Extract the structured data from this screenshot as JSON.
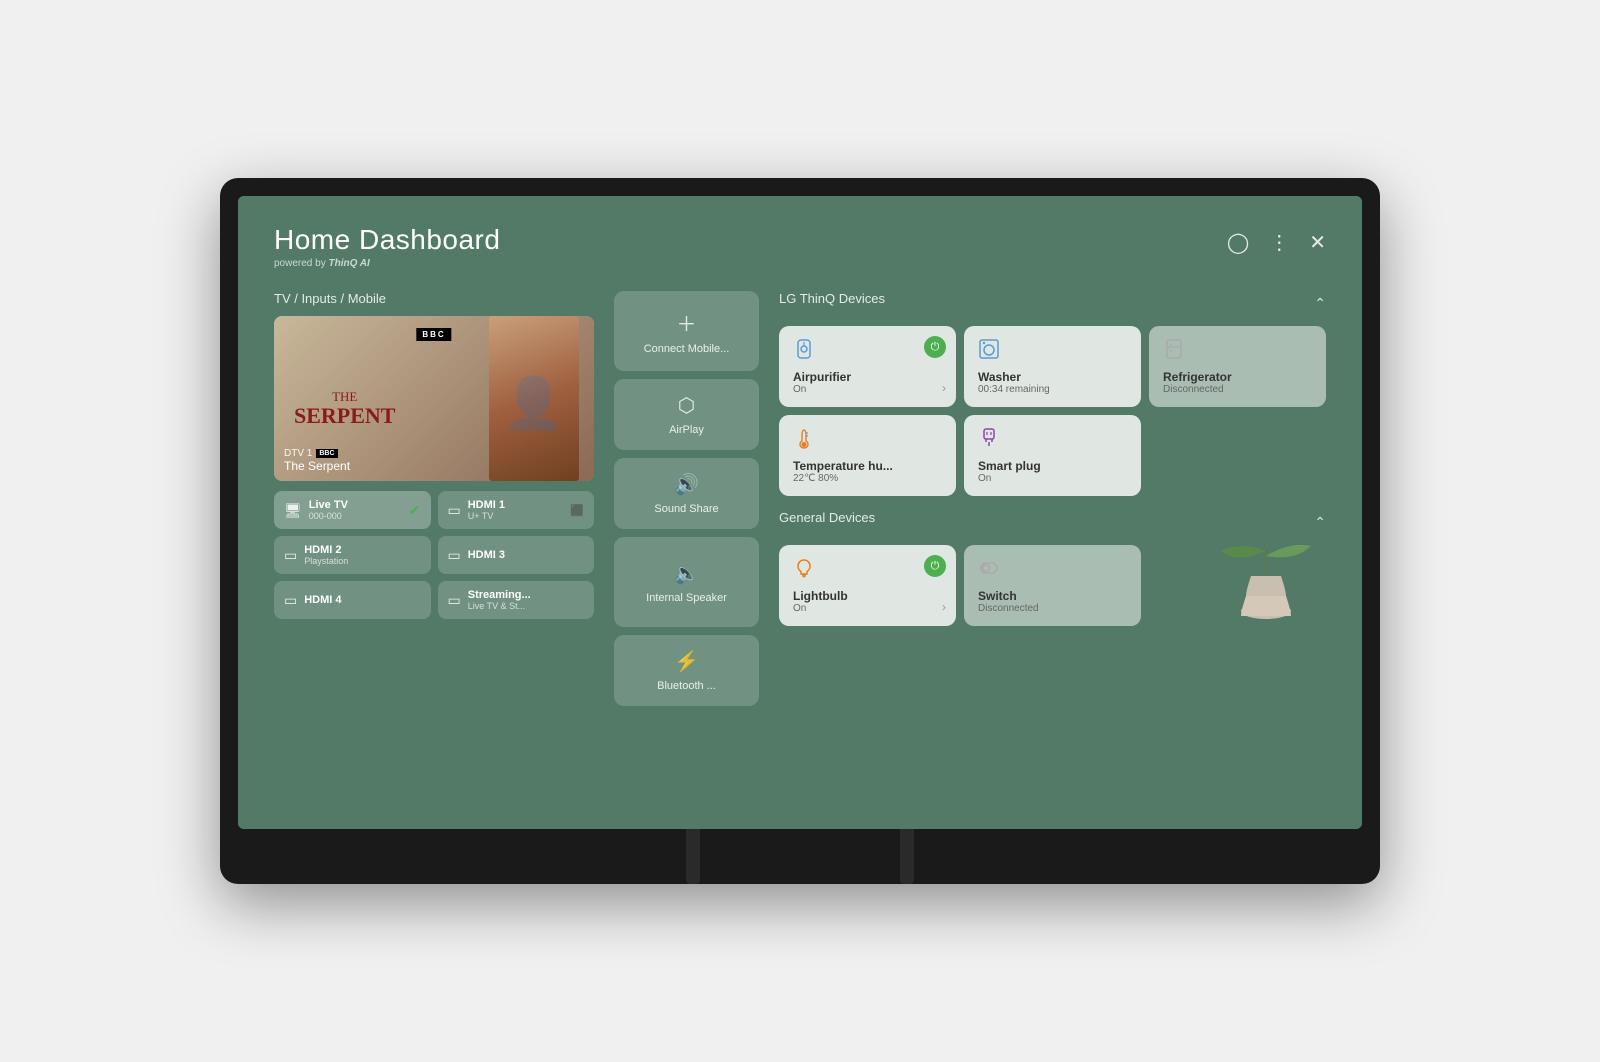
{
  "header": {
    "title": "Home Dashboard",
    "powered_by": "powered by",
    "thinq": "ThinQ AI"
  },
  "tv_inputs_section": {
    "title": "TV / Inputs / Mobile",
    "preview": {
      "channel": "DTV 1",
      "bbc_badge": "BBC",
      "show_name": "The Serpent",
      "show_title_the": "THE",
      "show_title_main": "SERPENT"
    },
    "inputs": [
      {
        "id": "live-tv",
        "name": "Live TV",
        "sub": "000-000",
        "active": true
      },
      {
        "id": "hdmi1",
        "name": "HDMI 1",
        "sub": "U+ TV",
        "active": false,
        "has_icon": true
      },
      {
        "id": "hdmi2",
        "name": "HDMI 2",
        "sub": "Playstation",
        "active": false
      },
      {
        "id": "hdmi3",
        "name": "HDMI 3",
        "sub": "",
        "active": false
      },
      {
        "id": "hdmi4",
        "name": "HDMI 4",
        "sub": "",
        "active": false
      },
      {
        "id": "streaming",
        "name": "Streaming...",
        "sub": "Live TV & St...",
        "active": false
      }
    ]
  },
  "mobile_panel": {
    "connect_label": "Connect Mobile...",
    "airplay_label": "AirPlay",
    "sound_share_label": "Sound Share",
    "internal_speaker_label": "Internal Speaker",
    "bluetooth_label": "Bluetooth ..."
  },
  "thinq_devices": {
    "section_title": "LG ThinQ Devices",
    "devices": [
      {
        "id": "airpurifier",
        "name": "Airpurifier",
        "status": "On",
        "icon": "🌀",
        "power": "on",
        "has_chevron": true
      },
      {
        "id": "washer",
        "name": "Washer",
        "status": "00:34 remaining",
        "icon": "🫧",
        "power": "none",
        "has_chevron": false
      },
      {
        "id": "refrigerator",
        "name": "Refrigerator",
        "status": "Disconnected",
        "icon": "🧊",
        "power": "none",
        "has_chevron": false,
        "dimmed": true
      },
      {
        "id": "temperature",
        "name": "Temperature hu...",
        "status": "22℃ 80%",
        "icon": "🌡️",
        "power": "none",
        "has_chevron": false
      },
      {
        "id": "smart-plug",
        "name": "Smart plug",
        "status": "On",
        "icon": "🔌",
        "power": "none",
        "has_chevron": false
      }
    ]
  },
  "general_devices": {
    "section_title": "General Devices",
    "devices": [
      {
        "id": "lightbulb",
        "name": "Lightbulb",
        "status": "On",
        "icon": "💡",
        "power": "on",
        "has_chevron": true
      },
      {
        "id": "switch",
        "name": "Switch",
        "status": "Disconnected",
        "icon": "🔲",
        "power": "none",
        "has_chevron": false,
        "dimmed": true
      }
    ]
  }
}
